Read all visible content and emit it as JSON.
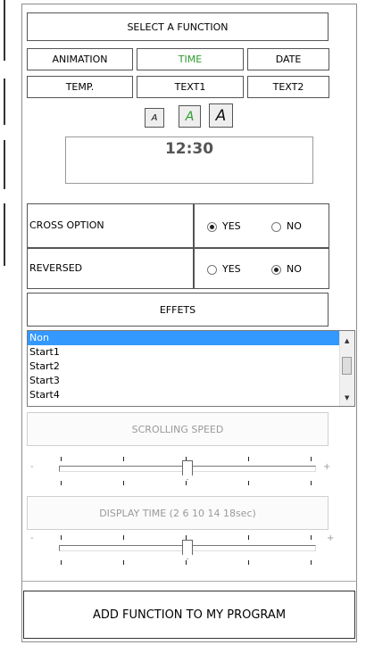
{
  "header": {
    "title": "SELECT A FUNCTION"
  },
  "functions": {
    "row1": [
      "ANIMATION",
      "TIME",
      "DATE"
    ],
    "row2": [
      "TEMP.",
      "TEXT1",
      "TEXT2"
    ],
    "selected": "TIME"
  },
  "font_sizes": [
    "A",
    "A",
    "A"
  ],
  "display": {
    "time": "12:30"
  },
  "cross_option": {
    "label": "CROSS OPTION",
    "yes": "YES",
    "no": "NO",
    "value": "YES"
  },
  "reversed": {
    "label": "REVERSED",
    "yes": "YES",
    "no": "NO",
    "value": "NO"
  },
  "effects": {
    "header": "EFFETS",
    "items": [
      "Non",
      "Start1",
      "Start2",
      "Start3",
      "Start4"
    ],
    "selected": "Non"
  },
  "scrolling_speed": {
    "label": "SCROLLING SPEED",
    "minus": "-",
    "plus": "+",
    "value": 0.5
  },
  "display_time": {
    "label": "DISPLAY TIME (2 6 10 14 18sec)",
    "minus": "-",
    "plus": "+",
    "value": 0.5
  },
  "footer": {
    "add_label": "ADD FUNCTION TO MY PROGRAM"
  },
  "colors": {
    "accent_selected": "#3399ff",
    "time_text": "#2e9c2e"
  }
}
